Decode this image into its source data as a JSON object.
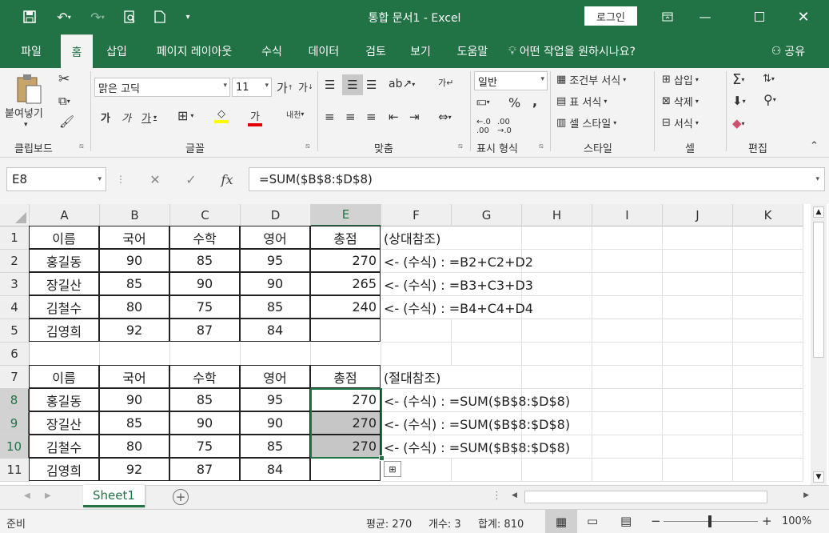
{
  "titlebar": {
    "title": "통합 문서1 - Excel",
    "login": "로그인"
  },
  "tabs": [
    "파일",
    "홈",
    "삽입",
    "페이지 레이아웃",
    "수식",
    "데이터",
    "검토",
    "보기",
    "도움말"
  ],
  "tellme": "어떤 작업을 원하시나요?",
  "share": "공유",
  "ribbon": {
    "paste": "붙여넣기",
    "font_name": "맑은 고딕",
    "font_size": "11",
    "number_format": "일반",
    "conditional": "조건부 서식",
    "table_format": "표 서식",
    "cell_style": "셀 스타일",
    "insert": "삽입",
    "delete": "삭제",
    "format": "서식",
    "groups": {
      "clipboard": "클립보드",
      "font": "글꼴",
      "align": "맞춤",
      "number": "표시 형식",
      "style": "스타일",
      "cells": "셀",
      "edit": "편집"
    }
  },
  "namebox": "E8",
  "formula": "=SUM($B$8:$D$8)",
  "columns": [
    "A",
    "B",
    "C",
    "D",
    "E",
    "F",
    "G",
    "H",
    "I",
    "J",
    "K"
  ],
  "rows": [
    "1",
    "2",
    "3",
    "4",
    "5",
    "6",
    "7",
    "8",
    "9",
    "10",
    "11"
  ],
  "cells": {
    "r1": {
      "A": "이름",
      "B": "국어",
      "C": "수학",
      "D": "영어",
      "E": "총점",
      "F": "(상대참조)"
    },
    "r2": {
      "A": "홍길동",
      "B": "90",
      "C": "85",
      "D": "95",
      "E": "270",
      "F": "<- (수식) : =B2+C2+D2"
    },
    "r3": {
      "A": "장길산",
      "B": "85",
      "C": "90",
      "D": "90",
      "E": "265",
      "F": "<- (수식) : =B3+C3+D3"
    },
    "r4": {
      "A": "김철수",
      "B": "80",
      "C": "75",
      "D": "85",
      "E": "240",
      "F": "<- (수식) : =B4+C4+D4"
    },
    "r5": {
      "A": "김영희",
      "B": "92",
      "C": "87",
      "D": "84"
    },
    "r7": {
      "A": "이름",
      "B": "국어",
      "C": "수학",
      "D": "영어",
      "E": "총점",
      "F": "(절대참조)"
    },
    "r8": {
      "A": "홍길동",
      "B": "90",
      "C": "85",
      "D": "95",
      "E": "270",
      "F": "<- (수식) : =SUM($B$8:$D$8)"
    },
    "r9": {
      "A": "장길산",
      "B": "85",
      "C": "90",
      "D": "90",
      "E": "270",
      "F": "<- (수식) : =SUM($B$8:$D$8)"
    },
    "r10": {
      "A": "김철수",
      "B": "80",
      "C": "75",
      "D": "85",
      "E": "270",
      "F": "<- (수식) : =SUM($B$8:$D$8)"
    },
    "r11": {
      "A": "김영희",
      "B": "92",
      "C": "87",
      "D": "84"
    }
  },
  "sheet": "Sheet1",
  "status": {
    "ready": "준비",
    "average": "평균: 270",
    "count": "개수: 3",
    "sum": "합계: 810",
    "zoom": "100%"
  },
  "colors": {
    "accent": "#217346",
    "selection": "#c6c6c6"
  }
}
